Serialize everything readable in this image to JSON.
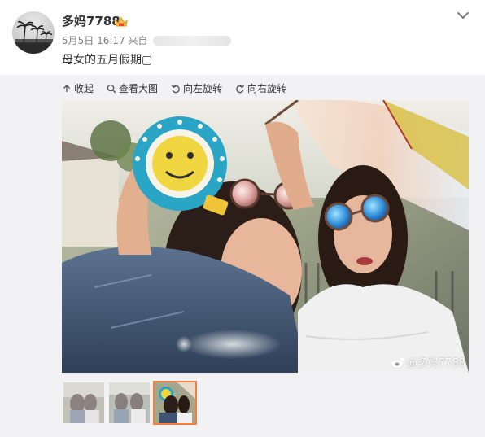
{
  "post": {
    "author": {
      "name": "多妈7788",
      "badge": "vip-crown-icon"
    },
    "meta": {
      "date": "5月5日",
      "time": "16:17",
      "source_prefix": "来自"
    },
    "text": "母女的五月假期▢"
  },
  "media": {
    "toolbar": {
      "collapse": "收起",
      "view_large": "查看大图",
      "rotate_left": "向左旋转",
      "rotate_right": "向右旋转"
    },
    "watermark": "@多妈7788",
    "thumbnails": [
      {
        "selected": false
      },
      {
        "selected": false
      },
      {
        "selected": true
      }
    ]
  },
  "colors": {
    "accent": "#fa7d3c",
    "panel_bg": "#f2f2f5",
    "meta_text": "#808080"
  }
}
